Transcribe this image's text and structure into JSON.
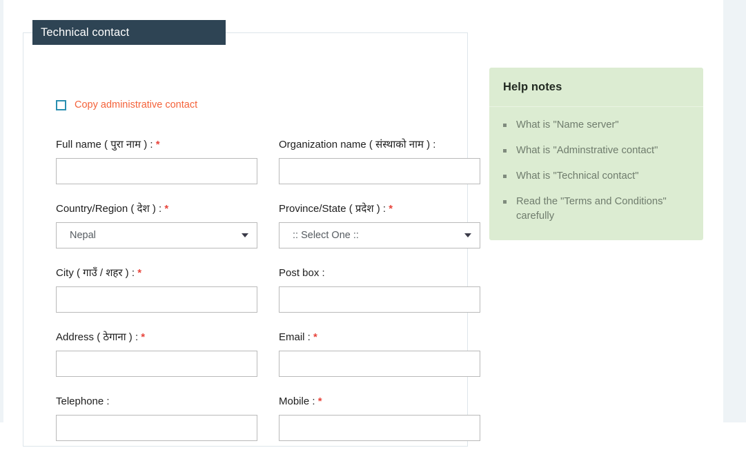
{
  "card": {
    "tab_title": "Technical contact",
    "copy_checkbox_label": "Copy administrative contact",
    "checkbox_checked": false
  },
  "colors": {
    "tab_background": "#2e4454",
    "copy_link": "#f4623a",
    "checkbox_border": "#2a8fb0",
    "required_asterisk": "#e8453c",
    "help_panel_background": "#dcecd2",
    "help_link": "#6f7c6d",
    "input_border": "#b9b9b9",
    "card_border": "#dde5ea",
    "page_edge_strip": "#eef3f6"
  },
  "form": {
    "rows": [
      {
        "left": {
          "label": "Full name ( पुरा नाम ) :",
          "required": true,
          "type": "text",
          "value": "",
          "placeholder": ""
        },
        "right": {
          "label": "Organization name ( संस्थाको नाम ) :",
          "required": false,
          "type": "text",
          "value": "",
          "placeholder": ""
        }
      },
      {
        "left": {
          "label": "Country/Region ( देश ) :",
          "required": true,
          "type": "select",
          "value": "Nepal"
        },
        "right": {
          "label": "Province/State ( प्रदेश ) :",
          "required": true,
          "type": "select",
          "value": ":: Select One ::"
        }
      },
      {
        "left": {
          "label": "City ( गाउँ / शहर ) :",
          "required": true,
          "type": "text",
          "value": "",
          "placeholder": ""
        },
        "right": {
          "label": "Post box :",
          "required": false,
          "type": "text",
          "value": "",
          "placeholder": ""
        }
      },
      {
        "left": {
          "label": "Address ( ठेगाना ) :",
          "required": true,
          "type": "text",
          "value": "",
          "placeholder": ""
        },
        "right": {
          "label": "Email :",
          "required": true,
          "type": "text",
          "value": "",
          "placeholder": ""
        }
      },
      {
        "left": {
          "label": "Telephone :",
          "required": false,
          "type": "text",
          "value": "",
          "placeholder": ""
        },
        "right": {
          "label": "Mobile :",
          "required": true,
          "type": "text",
          "value": "",
          "placeholder": ""
        }
      }
    ],
    "required_marker": "*"
  },
  "help": {
    "title": "Help notes",
    "items": [
      "What is \"Name server\"",
      "What is \"Adminstrative contact\"",
      "What is \"Technical contact\"",
      "Read the \"Terms and Conditions\" carefully"
    ]
  }
}
